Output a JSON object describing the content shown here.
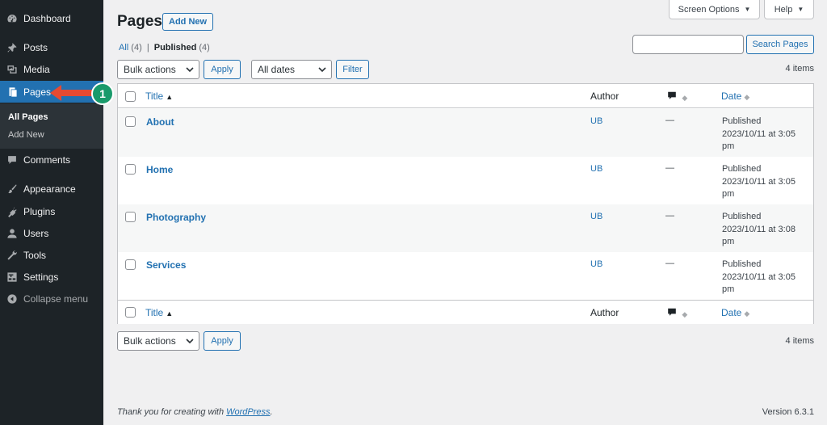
{
  "sidebar": {
    "items": [
      {
        "label": "Dashboard",
        "icon": "dashboard-icon"
      },
      {
        "label": "Posts",
        "icon": "pin-icon"
      },
      {
        "label": "Media",
        "icon": "media-icon"
      },
      {
        "label": "Pages",
        "icon": "pages-icon"
      },
      {
        "label": "Comments",
        "icon": "comment-icon"
      },
      {
        "label": "Appearance",
        "icon": "brush-icon"
      },
      {
        "label": "Plugins",
        "icon": "plugin-icon"
      },
      {
        "label": "Users",
        "icon": "user-icon"
      },
      {
        "label": "Tools",
        "icon": "wrench-icon"
      },
      {
        "label": "Settings",
        "icon": "settings-icon"
      }
    ],
    "submenu": [
      "All Pages",
      "Add New"
    ],
    "collapse_label": "Collapse menu"
  },
  "annotation": {
    "badge": "1",
    "color": "#e64a32",
    "badge_color": "#199a6b"
  },
  "header": {
    "screen_options": "Screen Options",
    "help": "Help",
    "title": "Pages",
    "add_new": "Add New"
  },
  "views": {
    "all_label": "All",
    "all_count": "(4)",
    "separator": "|",
    "published_label": "Published",
    "published_count": "(4)"
  },
  "search": {
    "button": "Search Pages",
    "value": ""
  },
  "toolbar": {
    "bulk_actions": "Bulk actions",
    "apply": "Apply",
    "dates": "All dates",
    "filter": "Filter",
    "items_count": "4 items"
  },
  "table": {
    "columns": {
      "title": "Title",
      "author": "Author",
      "date": "Date"
    },
    "rows": [
      {
        "title": "About",
        "author": "UB",
        "comments": "—",
        "status": "Published",
        "date": "2023/10/11 at 3:05",
        "time_suffix": "pm"
      },
      {
        "title": "Home",
        "author": "UB",
        "comments": "—",
        "status": "Published",
        "date": "2023/10/11 at 3:05",
        "time_suffix": "pm"
      },
      {
        "title": "Photography",
        "author": "UB",
        "comments": "—",
        "status": "Published",
        "date": "2023/10/11 at 3:08",
        "time_suffix": "pm"
      },
      {
        "title": "Services",
        "author": "UB",
        "comments": "—",
        "status": "Published",
        "date": "2023/10/11 at 3:05",
        "time_suffix": "pm"
      }
    ]
  },
  "footer": {
    "thanks_prefix": "Thank you for creating with",
    "thanks_link": "WordPress",
    "thanks_suffix": ".",
    "version": "Version 6.3.1"
  }
}
